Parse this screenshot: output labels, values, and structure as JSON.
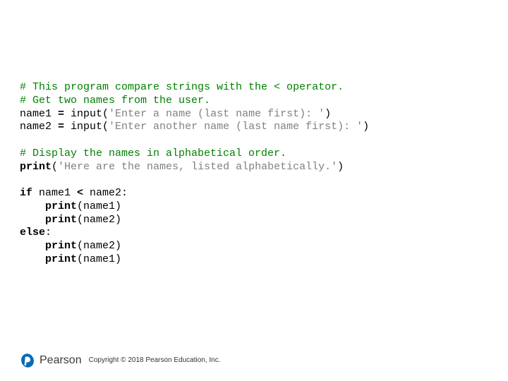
{
  "code": {
    "l1_comment": "# This program compare strings with the < operator.",
    "l2_comment": "# Get two names from the user.",
    "l3_a": "name1 ",
    "l3_eq": "=",
    "l3_b": " input(",
    "l3_str": "'Enter a name (last name first): '",
    "l3_c": ")",
    "l4_a": "name2 ",
    "l4_eq": "=",
    "l4_b": " input(",
    "l4_str": "'Enter another name (last name first): '",
    "l4_c": ")",
    "l5_comment": "# Display the names in alphabetical order.",
    "l6_fn": "print",
    "l6_p1": "(",
    "l6_str": "'Here are the names, listed alphabetically.'",
    "l6_p2": ")",
    "l7_if": "if",
    "l7_mid": " name1 ",
    "l7_lt": "<",
    "l7_end": " name2:",
    "l8_ind": "    ",
    "l8_fn": "print",
    "l8_arg": "(name1)",
    "l9_ind": "    ",
    "l9_fn": "print",
    "l9_arg": "(name2)",
    "l10_else": "else",
    "l10_colon": ":",
    "l11_ind": "    ",
    "l11_fn": "print",
    "l11_arg": "(name2)",
    "l12_ind": "    ",
    "l12_fn": "print",
    "l12_arg": "(name1)"
  },
  "footer": {
    "brand": "Pearson",
    "copyright": "Copyright © 2018 Pearson Education, Inc."
  }
}
